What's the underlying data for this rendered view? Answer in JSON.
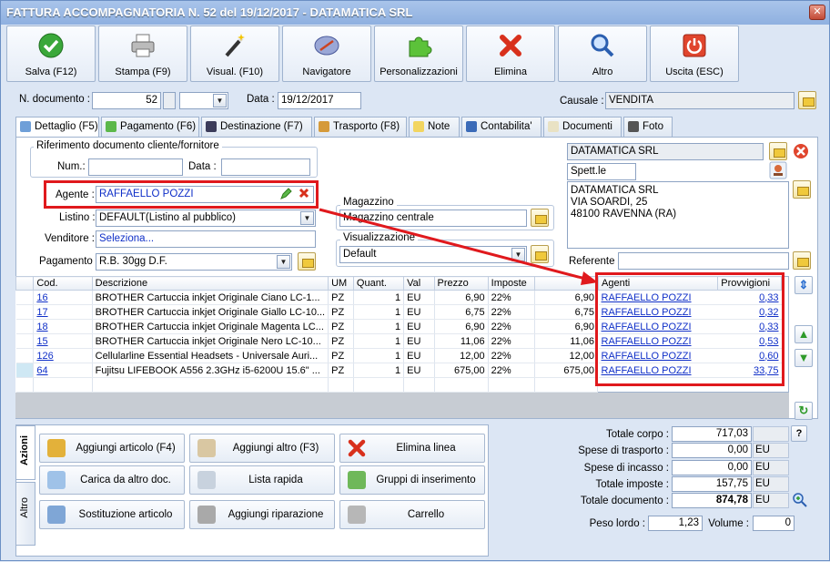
{
  "window": {
    "title": "FATTURA ACCOMPAGNATORIA N. 52 del 19/12/2017 - DATAMATICA SRL",
    "close": "✕"
  },
  "toolbar": [
    {
      "label": "Salva (F12)",
      "icon": "check-icon"
    },
    {
      "label": "Stampa (F9)",
      "icon": "printer-icon"
    },
    {
      "label": "Visual. (F10)",
      "icon": "magic-wand-icon"
    },
    {
      "label": "Navigatore",
      "icon": "compass-icon"
    },
    {
      "label": "Personalizzazioni",
      "icon": "puzzle-icon"
    },
    {
      "label": "Elimina",
      "icon": "delete-x-icon"
    },
    {
      "label": "Altro",
      "icon": "magnifier-icon"
    },
    {
      "label": "Uscita (ESC)",
      "icon": "power-icon"
    }
  ],
  "header": {
    "ndoc_label": "N. documento :",
    "ndoc_value": "52",
    "data_label": "Data :",
    "data_value": "19/12/2017",
    "causale_label": "Causale :",
    "causale_value": "VENDITA"
  },
  "tabs": [
    "Dettaglio (F5)",
    "Pagamento (F6)",
    "Destinazione (F7)",
    "Trasporto (F8)",
    "Note",
    "Contabilita'",
    "Documenti",
    "Foto"
  ],
  "riferimento": {
    "title": "Riferimento documento cliente/fornitore",
    "num_label": "Num.:",
    "data_label": "Data :"
  },
  "agente": {
    "label": "Agente :",
    "value": "RAFFAELLO POZZI"
  },
  "listino": {
    "label": "Listino :",
    "value": "DEFAULT(Listino al pubblico)"
  },
  "venditore": {
    "label": "Venditore :",
    "value": "Seleziona..."
  },
  "pagamento": {
    "label": "Pagamento :",
    "value": "R.B. 30gg D.F."
  },
  "magazzino": {
    "title": "Magazzino",
    "value": "Magazzino centrale"
  },
  "visualizzazione": {
    "title": "Visualizzazione",
    "value": "Default"
  },
  "cliente": {
    "name": "DATAMATICA SRL",
    "spett": "Spett.le",
    "address": [
      "DATAMATICA SRL",
      "VIA SOARDI, 25",
      "48100 RAVENNA (RA)"
    ],
    "referente_label": "Referente"
  },
  "grid": {
    "headers": [
      "Cod.",
      "Descrizione",
      "UM",
      "Quant.",
      "Val",
      "Prezzo",
      "Imposte",
      "",
      ""
    ],
    "rows": [
      {
        "cod": "16",
        "desc": "BROTHER Cartuccia inkjet Originale Ciano LC-1...",
        "um": "PZ",
        "qty": "1",
        "val": "EU",
        "prezzo": "6,90",
        "imposte": "22%",
        "tot": "6,90"
      },
      {
        "cod": "17",
        "desc": "BROTHER Cartuccia inkjet Originale Giallo LC-10...",
        "um": "PZ",
        "qty": "1",
        "val": "EU",
        "prezzo": "6,75",
        "imposte": "22%",
        "tot": "6,75"
      },
      {
        "cod": "18",
        "desc": "BROTHER Cartuccia inkjet Originale Magenta LC...",
        "um": "PZ",
        "qty": "1",
        "val": "EU",
        "prezzo": "6,90",
        "imposte": "22%",
        "tot": "6,90"
      },
      {
        "cod": "15",
        "desc": "BROTHER Cartuccia inkjet Originale Nero LC-10...",
        "um": "PZ",
        "qty": "1",
        "val": "EU",
        "prezzo": "11,06",
        "imposte": "22%",
        "tot": "11,06"
      },
      {
        "cod": "126",
        "desc": "Cellularline Essential Headsets - Universale Auri...",
        "um": "PZ",
        "qty": "1",
        "val": "EU",
        "prezzo": "12,00",
        "imposte": "22%",
        "tot": "12,00"
      },
      {
        "cod": "64",
        "desc": "Fujitsu LIFEBOOK A556 2.3GHz i5-6200U 15.6\" ...",
        "um": "PZ",
        "qty": "1",
        "val": "EU",
        "prezzo": "675,00",
        "imposte": "22%",
        "tot": "675,00"
      }
    ]
  },
  "agenti": {
    "headers": [
      "Agenti",
      "Provvigioni"
    ],
    "rows": [
      {
        "agente": "RAFFAELLO POZZI",
        "provv": "0,33"
      },
      {
        "agente": "RAFFAELLO POZZI",
        "provv": "0,32"
      },
      {
        "agente": "RAFFAELLO POZZI",
        "provv": "0,33"
      },
      {
        "agente": "RAFFAELLO POZZI",
        "provv": "0,53"
      },
      {
        "agente": "RAFFAELLO POZZI",
        "provv": "0,60"
      },
      {
        "agente": "RAFFAELLO POZZI",
        "provv": "33,75"
      }
    ]
  },
  "actions": {
    "vtabs": [
      "Azioni",
      "Altro"
    ],
    "buttons": [
      "Aggiungi articolo (F4)",
      "Aggiungi altro (F3)",
      "Elimina linea",
      "Carica da altro doc.",
      "Lista rapida",
      "Gruppi di inserimento",
      "Sostituzione articolo",
      "Aggiungi riparazione",
      "Carrello"
    ]
  },
  "totali": {
    "corpo_label": "Totale corpo :",
    "corpo": "717,03",
    "help": "?",
    "trasporto_label": "Spese di trasporto :",
    "trasporto": "0,00",
    "incasso_label": "Spese di incasso :",
    "incasso": "0,00",
    "imposte_label": "Totale imposte :",
    "imposte": "157,75",
    "documento_label": "Totale documento :",
    "documento": "874,78",
    "currency": "EU",
    "peso_label": "Peso lordo :",
    "peso": "1,23",
    "volume_label": "Volume :",
    "volume": "0"
  },
  "colors": {
    "highlight": "#e0191d",
    "link": "#0f2fc8"
  }
}
